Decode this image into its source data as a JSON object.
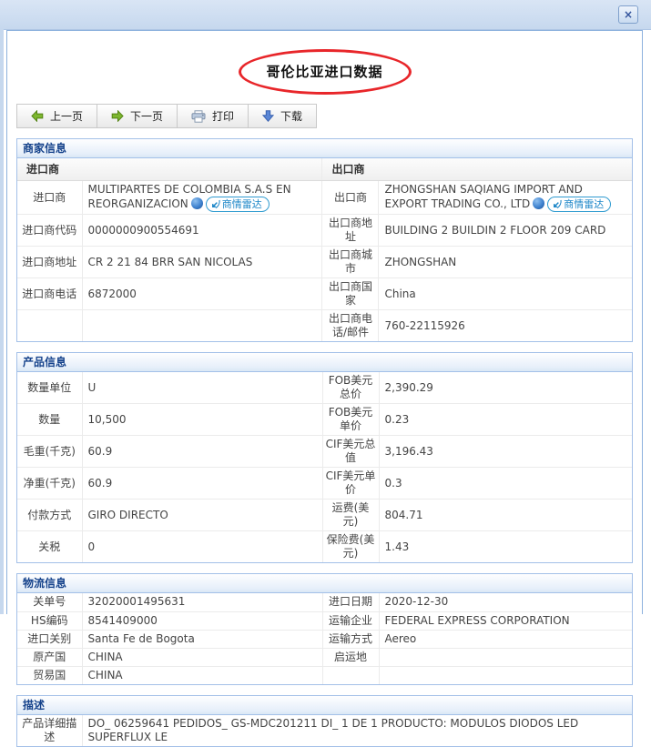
{
  "window": {
    "close_icon": "×"
  },
  "page_title": "哥伦比亚进口数据",
  "toolbar": {
    "prev_label": "上一页",
    "next_label": "下一页",
    "print_label": "打印",
    "download_label": "下载"
  },
  "merchant_info": {
    "header": "商家信息",
    "importer_col_header": "进口商",
    "exporter_col_header": "出口商",
    "importer_name_label": "进口商",
    "importer_name": "MULTIPARTES DE COLOMBIA S.A.S EN REORGANIZACION",
    "exporter_name_label": "出口商",
    "exporter_name": "ZHONGSHAN SAQIANG IMPORT AND EXPORT TRADING CO., LTD",
    "radar_badge_label": "商情雷达",
    "rows": [
      {
        "l1": "进口商代码",
        "v1": "0000000900554691",
        "l2": "出口商地址",
        "v2": "BUILDING 2 BUILDIN 2 FLOOR 209 CARD"
      },
      {
        "l1": "进口商地址",
        "v1": "CR 2 21 84 BRR SAN NICOLAS",
        "l2": "出口商城市",
        "v2": "ZHONGSHAN"
      },
      {
        "l1": "进口商电话",
        "v1": "6872000",
        "l2": "出口商国家",
        "v2": "China"
      },
      {
        "l1": "",
        "v1": "",
        "l2": "出口商电话/邮件",
        "v2": "760-22115926"
      }
    ]
  },
  "product_info": {
    "header": "产品信息",
    "rows": [
      {
        "l1": "数量单位",
        "v1": "U",
        "l2": "FOB美元总价",
        "v2": "2,390.29"
      },
      {
        "l1": "数量",
        "v1": "10,500",
        "l2": "FOB美元单价",
        "v2": "0.23"
      },
      {
        "l1": "毛重(千克)",
        "v1": "60.9",
        "l2": "CIF美元总值",
        "v2": "3,196.43"
      },
      {
        "l1": "净重(千克)",
        "v1": "60.9",
        "l2": "CIF美元单价",
        "v2": "0.3"
      },
      {
        "l1": "付款方式",
        "v1": "GIRO DIRECTO",
        "l2": "运费(美元)",
        "v2": "804.71"
      },
      {
        "l1": "关税",
        "v1": "0",
        "l2": "保险费(美元)",
        "v2": "1.43"
      }
    ]
  },
  "logistics_info": {
    "header": "物流信息",
    "rows": [
      {
        "l1": "关单号",
        "v1": "32020001495631",
        "l2": "进口日期",
        "v2": "2020-12-30"
      },
      {
        "l1": "HS编码",
        "v1": "8541409000",
        "l2": "运输企业",
        "v2": "FEDERAL EXPRESS CORPORATION"
      },
      {
        "l1": "进口关别",
        "v1": "Santa Fe de Bogota",
        "l2": "运输方式",
        "v2": "Aereo"
      },
      {
        "l1": "原产国",
        "v1": "CHINA",
        "l2": "启运地",
        "v2": ""
      },
      {
        "l1": "贸易国",
        "v1": "CHINA",
        "l2": "",
        "v2": ""
      }
    ]
  },
  "description": {
    "header": "描述",
    "label": "产品详细描述",
    "value": "DO_ 06259641 PEDIDOS_ GS-MDC201211 DI_ 1 DE 1 PRODUCTO: MODULOS DIODOS LED SUPERFLUX LE"
  },
  "colors": {
    "titlebar_bg": "#cddcf0",
    "panel_border": "#8db1dd",
    "section_border": "#a3c0e8",
    "section_header_text": "#15428b",
    "radar_blue": "#1c86c8",
    "red_annotation": "#e8262a",
    "green_arrow": "#7db72f",
    "download_blue": "#5b87d6"
  }
}
